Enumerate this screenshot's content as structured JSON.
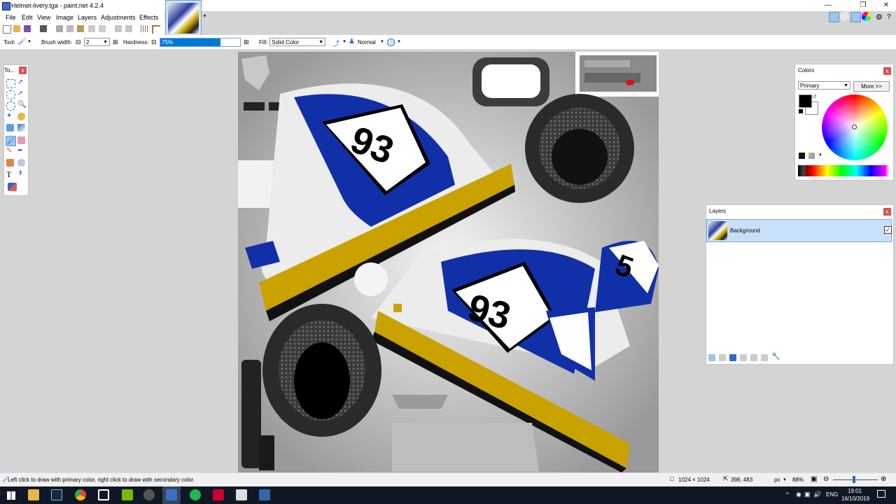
{
  "window": {
    "title": "Helmet-livery.tga - paint.net 4.2.4"
  },
  "menu": [
    "File",
    "Edit",
    "View",
    "Image",
    "Layers",
    "Adjustments",
    "Effects"
  ],
  "options": {
    "tool_label": "Tool:",
    "brush_width_label": "Brush width:",
    "brush_width_value": "2",
    "hardness_label": "Hardness:",
    "hardness_value": "75%",
    "hardness_fraction": 0.75,
    "fill_label": "Fill:",
    "fill_value": "Solid Color",
    "blend_mode": "Normal"
  },
  "tools_panel": {
    "title": "To...",
    "close": "x"
  },
  "canvas": {
    "number_primary": "93",
    "number_secondary": "93",
    "number_partial": "5"
  },
  "colors_panel": {
    "title": "Colors",
    "close": "x",
    "mode": "Primary",
    "more_button": "More >>",
    "primary_color": "#000000",
    "secondary_color": "#ffffff"
  },
  "layers_panel": {
    "title": "Layers",
    "close": "x",
    "layers": [
      {
        "name": "Background",
        "visible": true
      }
    ]
  },
  "status": {
    "hint": "Left click to draw with primary color, right click to draw with secondary color.",
    "image_size": "1024 × 1024",
    "cursor_pos": "398, 483",
    "units": "px",
    "zoom": "88%"
  },
  "taskbar": {
    "lang": "ENG",
    "time": "19:01",
    "date": "16/10/2019"
  },
  "colors": {
    "accent": "#0078d7",
    "livery_blue": "#1130a8",
    "livery_gold": "#c9a200",
    "layer_selected": "#c8e0f7"
  }
}
